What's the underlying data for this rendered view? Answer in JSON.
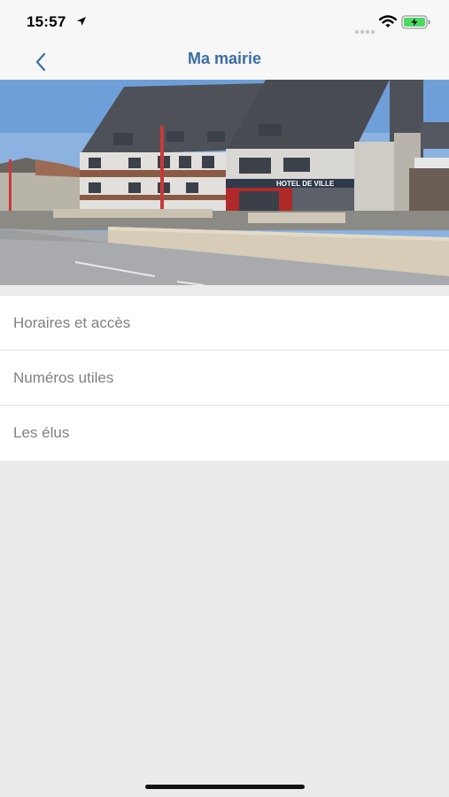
{
  "status_bar": {
    "time": "15:57",
    "icons": [
      "location-arrow-icon",
      "signal-icon",
      "wifi-icon",
      "battery-charging-icon"
    ]
  },
  "nav": {
    "title": "Ma mairie",
    "back_icon": "chevron-left-icon"
  },
  "hero": {
    "sign_text": "HOTEL DE VILLE"
  },
  "menu": {
    "items": [
      {
        "label": "Horaires et accès"
      },
      {
        "label": "Numéros utiles"
      },
      {
        "label": "Les élus"
      }
    ]
  },
  "colors": {
    "accent": "#3a6ea5",
    "background": "#ebebeb",
    "bar_background": "#f7f7f7",
    "list_text": "#808080",
    "battery_fill": "#4cd964"
  }
}
